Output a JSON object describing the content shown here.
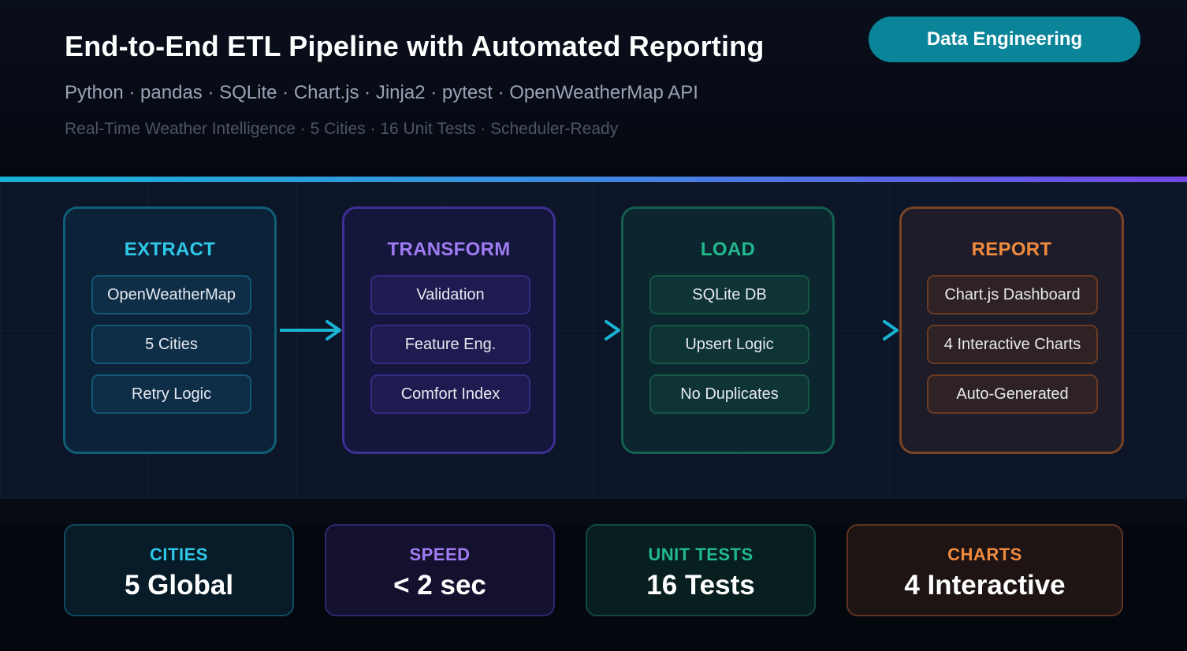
{
  "header": {
    "title": "End-to-End ETL Pipeline with Automated Reporting",
    "subtitle": "Python · pandas · SQLite · Chart.js · Jinja2 · pytest · OpenWeatherMap API",
    "tagline": "Real-Time Weather Intelligence · 5 Cities · 16 Unit Tests · Scheduler-Ready",
    "badge": "Data Engineering"
  },
  "pipeline": {
    "stages": [
      {
        "title": "EXTRACT",
        "color": "#2ec8e8",
        "items": [
          "OpenWeatherMap",
          "5 Cities",
          "Retry Logic"
        ]
      },
      {
        "title": "TRANSFORM",
        "color": "#a07cf2",
        "items": [
          "Validation",
          "Feature Eng.",
          "Comfort Index"
        ]
      },
      {
        "title": "LOAD",
        "color": "#22b98d",
        "items": [
          "SQLite DB",
          "Upsert Logic",
          "No Duplicates"
        ]
      },
      {
        "title": "REPORT",
        "color": "#f08a3e",
        "items": [
          "Chart.js Dashboard",
          "4 Interactive Charts",
          "Auto-Generated"
        ]
      }
    ]
  },
  "stats": [
    {
      "label": "CITIES",
      "value": "5 Global",
      "color": "#2ec8e8"
    },
    {
      "label": "SPEED",
      "value": "< 2 sec",
      "color": "#a07cf2"
    },
    {
      "label": "UNIT TESTS",
      "value": "16 Tests",
      "color": "#22b98d"
    },
    {
      "label": "CHARTS",
      "value": "4 Interactive",
      "color": "#f08a3e"
    }
  ]
}
